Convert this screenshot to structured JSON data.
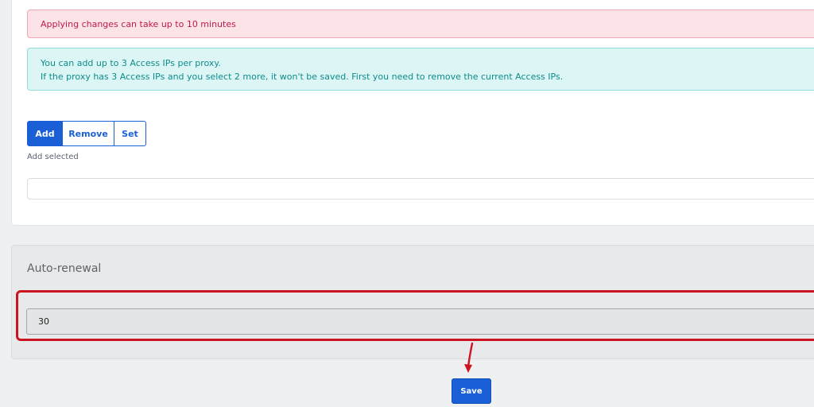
{
  "alerts": {
    "danger": "Applying changes can take up to 10 minutes",
    "info_line1": "You can add up to 3 Access IPs per proxy.",
    "info_line2": "If the proxy has 3 Access IPs and you select 2 more, it won't be saved. First you need to remove the current Access IPs."
  },
  "access_ip_mode": {
    "buttons": [
      "Add",
      "Remove",
      "Set"
    ],
    "active": "Add",
    "status_label": "Add selected"
  },
  "access_ip_input": {
    "value": "",
    "placeholder": ""
  },
  "auto_renewal": {
    "title": "Auto-renewal",
    "value": "30"
  },
  "save_button": {
    "label": "Save"
  },
  "colors": {
    "primary": "#1a5fd6",
    "danger_bg": "#fbe3e7",
    "danger_text": "#c21c47",
    "info_bg": "#dcf5f5",
    "info_text": "#0f8c8c",
    "annotation": "#cc1420"
  },
  "icons": {
    "annotation_arrow": "arrow-down-icon"
  }
}
